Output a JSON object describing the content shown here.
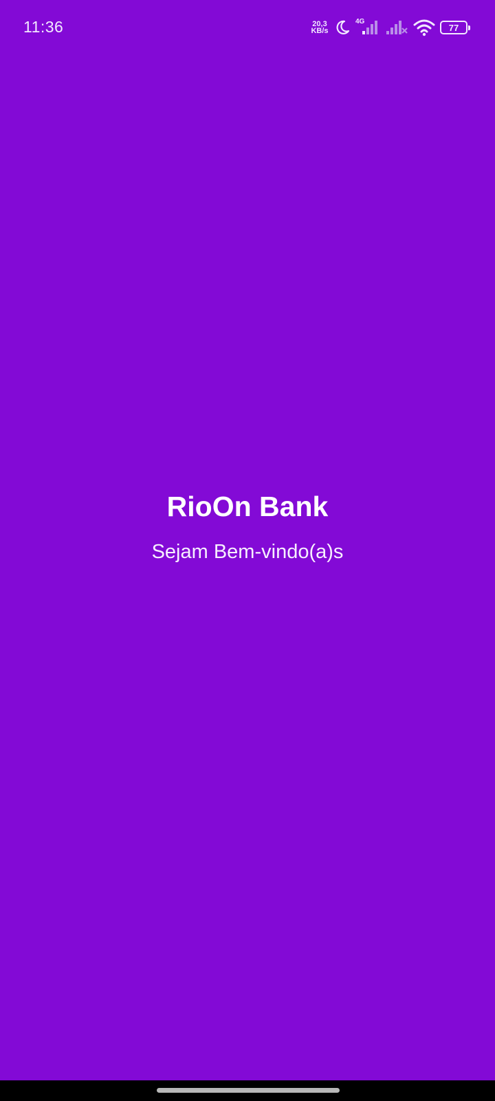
{
  "status_bar": {
    "time": "11:36",
    "net_speed_value": "20,3",
    "net_speed_unit": "KB/s",
    "network_type": "4G",
    "battery_level": "77",
    "icons": [
      "moon-icon",
      "signal-icon",
      "signal-no-service-icon",
      "wifi-icon",
      "battery-icon"
    ]
  },
  "splash": {
    "title": "RioOn Bank",
    "subtitle": "Sejam Bem-vindo(a)s"
  },
  "colors": {
    "background": "#830ad6",
    "text": "#ffffff",
    "nav_bar": "#000000"
  }
}
